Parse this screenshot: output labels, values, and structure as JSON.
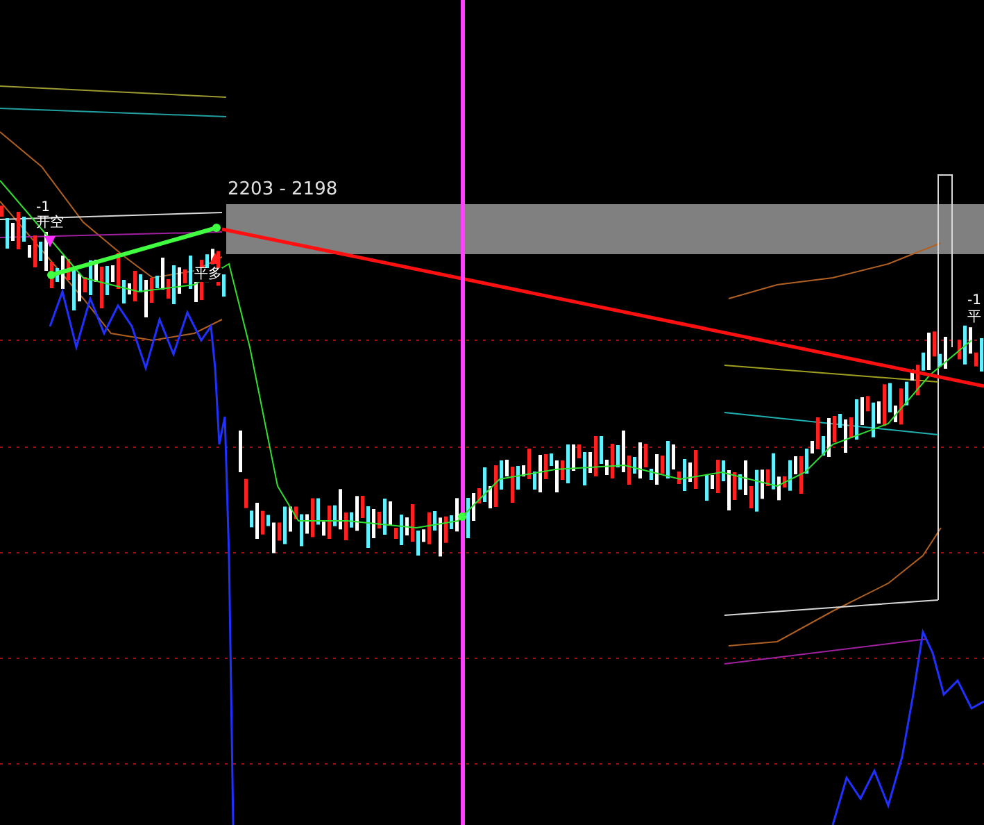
{
  "price_range": {
    "label": "2203 - 2198"
  },
  "signals": [
    {
      "label": "-1"
    },
    {
      "label": "开空"
    },
    {
      "label": "平多"
    },
    {
      "label": "-1"
    },
    {
      "label": "平"
    }
  ]
}
